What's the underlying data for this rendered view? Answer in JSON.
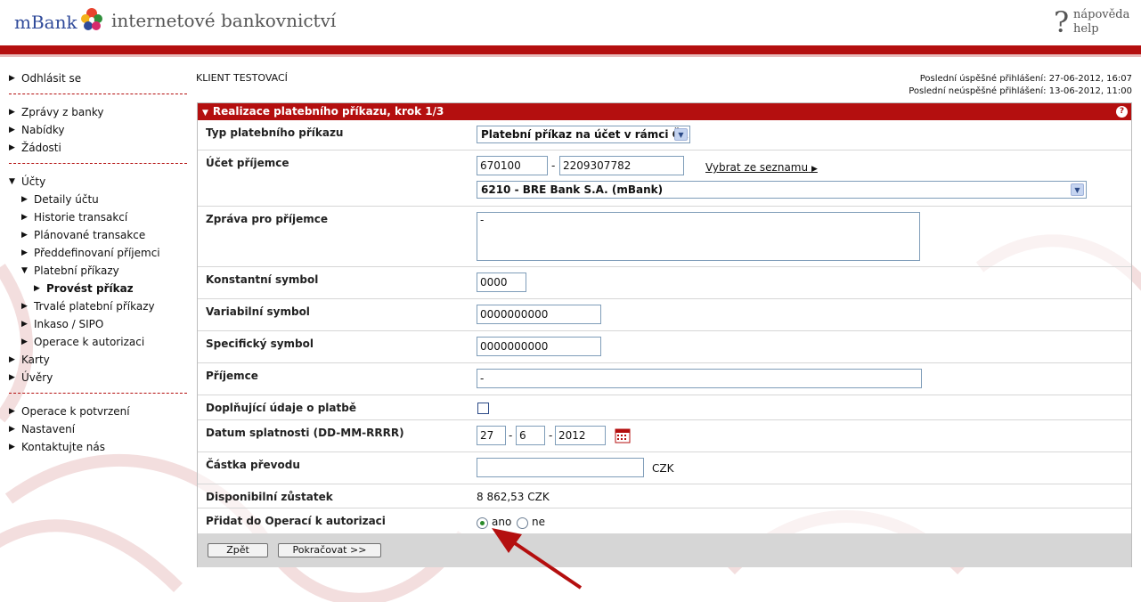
{
  "header": {
    "logo_text": "mBank",
    "app_title": "internetové bankovnictví",
    "help_symbol": "?",
    "help_cz": "nápověda",
    "help_en": "help",
    "brand_red": "#b40f0f"
  },
  "sidebar": {
    "logout": "Odhlásit se",
    "group1": [
      "Zprávy z banky",
      "Nabídky",
      "Žádosti"
    ],
    "accounts": "Účty",
    "account_items": [
      "Detaily účtu",
      "Historie transakcí",
      "Plánované transakce",
      "Předdefinovaní příjemci"
    ],
    "payment_orders": "Platební příkazy",
    "execute_order": "Provést příkaz",
    "account_items2": [
      "Trvalé platební příkazy",
      "Inkaso / SIPO",
      "Operace k autorizaci"
    ],
    "cards": "Karty",
    "loans": "Úvěry",
    "group3": [
      "Operace k potvrzení",
      "Nastavení",
      "Kontaktujte nás"
    ]
  },
  "client": {
    "name": "KLIENT TESTOVACÍ",
    "last_success": "Poslední úspěšné přihlášení: 27-06-2012, 16:07",
    "last_fail": "Poslední neúspěšné přihlášení: 13-06-2012, 11:00"
  },
  "panel": {
    "title": "Realizace platebního příkazu, krok 1/3",
    "help_icon": "?"
  },
  "form": {
    "type_label": "Typ platebního příkazu",
    "type_value": "Platební příkaz na účet v rámci ČR",
    "account_label": "Účet příjemce",
    "account_prefix": "670100",
    "account_number": "2209307782",
    "choose_from_list": "Vybrat ze seznamu",
    "bank_value": "6210 - BRE Bank S.A. (mBank)",
    "message_label": "Zpráva pro příjemce",
    "message_value": "-",
    "const_label": "Konstantní symbol",
    "const_value": "0000",
    "var_label": "Variabilní symbol",
    "var_value": "0000000000",
    "spec_label": "Specifický symbol",
    "spec_value": "0000000000",
    "recipient_label": "Příjemce",
    "recipient_value": "-",
    "extra_label": "Doplňující údaje o platbě",
    "date_label": "Datum splatnosti (DD-MM-RRRR)",
    "date_day": "27",
    "date_month": "6",
    "date_year": "2012",
    "amount_label": "Částka převodu",
    "amount_value": "",
    "currency": "CZK",
    "balance_label": "Disponibilní zůstatek",
    "balance_value": "8 862,53 CZK",
    "auth_label": "Přidat do Operací k autorizaci",
    "auth_yes": "ano",
    "auth_no": "ne",
    "dash": "-"
  },
  "buttons": {
    "back": "Zpět",
    "continue": "Pokračovat >>"
  }
}
